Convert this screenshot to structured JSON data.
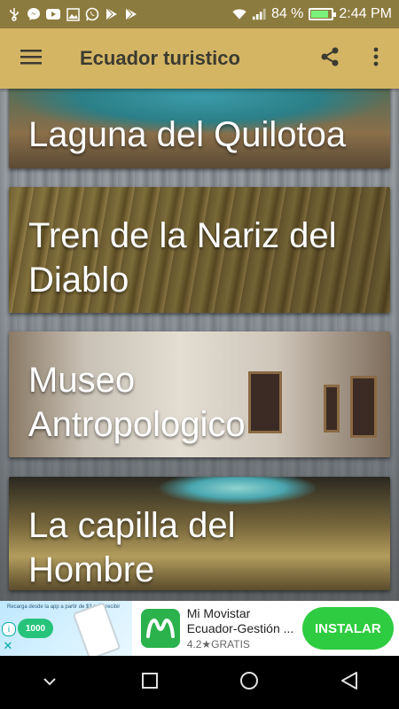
{
  "status_bar": {
    "battery_percent": "84 %",
    "battery_level": 0.84,
    "time": "2:44 PM",
    "left_icons": [
      "usb-icon",
      "messenger-icon",
      "youtube-icon",
      "gallery-icon",
      "whatsapp-icon",
      "play-store-icon",
      "play-store-icon"
    ],
    "right_icons": [
      "wifi-icon",
      "signal-icon",
      "battery-icon"
    ]
  },
  "app_bar": {
    "title": "Ecuador turistico",
    "background": "#d4b564",
    "icons": [
      "menu-icon",
      "share-icon",
      "more-vert-icon"
    ]
  },
  "cards": [
    {
      "label": "Laguna del Quilotoa"
    },
    {
      "label": "Tren de la Nariz del Diablo"
    },
    {
      "label": "Museo Antropologico"
    },
    {
      "label": "La capilla del Hombre"
    }
  ],
  "ad": {
    "app_name": "Mi Movistar Ecuador-Gestión ...",
    "rating": "4.2★GRATIS",
    "install_label": "INSTALAR",
    "image_promo_text": "Recarga desde la app a partir de $3 para recibir",
    "image_promo_badge": "1000",
    "install_color": "#2ecc40"
  },
  "nav_bar": {
    "icons": [
      "hide-keyboard-icon",
      "recents-icon",
      "home-icon",
      "back-icon"
    ]
  }
}
